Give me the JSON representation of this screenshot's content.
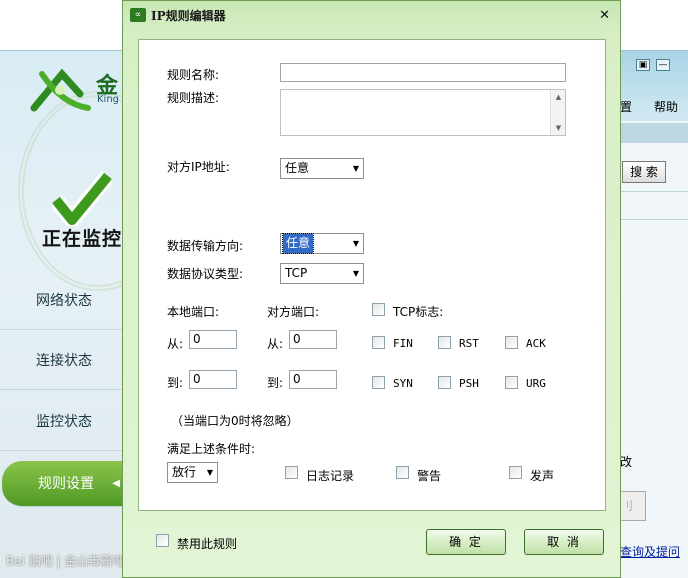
{
  "background_app": {
    "logo_text": "金",
    "logo_sub": "King",
    "status_text": "正在监控",
    "nav": [
      {
        "label": "网络状态"
      },
      {
        "label": "连接状态"
      },
      {
        "label": "监控状态"
      },
      {
        "label": "规则设置"
      }
    ],
    "watermark": "Bai 贴吧 | 金山毒霸吧",
    "right_menu": [
      "置",
      "帮助"
    ],
    "search_label": "搜 索",
    "fragment_gai": "改",
    "fragment_btn": "刂",
    "link_text": "查询及提问",
    "win_buttons": [
      "▣",
      "—"
    ]
  },
  "dialog": {
    "title_icon": "∝",
    "title": "IP规则编辑器",
    "close_glyph": "✕",
    "rule_name": {
      "label": "规则名称:",
      "value": ""
    },
    "rule_desc": {
      "label": "规则描述:",
      "value": ""
    },
    "remote_ip": {
      "label": "对方IP地址:",
      "value": "任意"
    },
    "direction": {
      "label": "数据传输方向:",
      "value": "任意"
    },
    "protocol": {
      "label": "数据协议类型:",
      "value": "TCP"
    },
    "local_port": {
      "label": "本地端口:",
      "from_label": "从:",
      "from_value": "0",
      "to_label": "到:",
      "to_value": "0"
    },
    "remote_port": {
      "label": "对方端口:",
      "from_label": "从:",
      "from_value": "0",
      "to_label": "到:",
      "to_value": "0"
    },
    "tcp_flags": {
      "label": "TCP标志:",
      "flags": [
        "FIN",
        "RST",
        "ACK",
        "SYN",
        "PSH",
        "URG"
      ]
    },
    "port_note": "（当端口为0时将忽略）",
    "condition_label": "满足上述条件时:",
    "action": {
      "value": "放行"
    },
    "log_label": "日志记录",
    "alert_label": "警告",
    "sound_label": "发声",
    "disable_label": "禁用此规则",
    "ok_label": "确 定",
    "cancel_label": "取 消",
    "dropdown_arrow": "▼",
    "scroll_up": "▲",
    "scroll_down": "▼"
  }
}
